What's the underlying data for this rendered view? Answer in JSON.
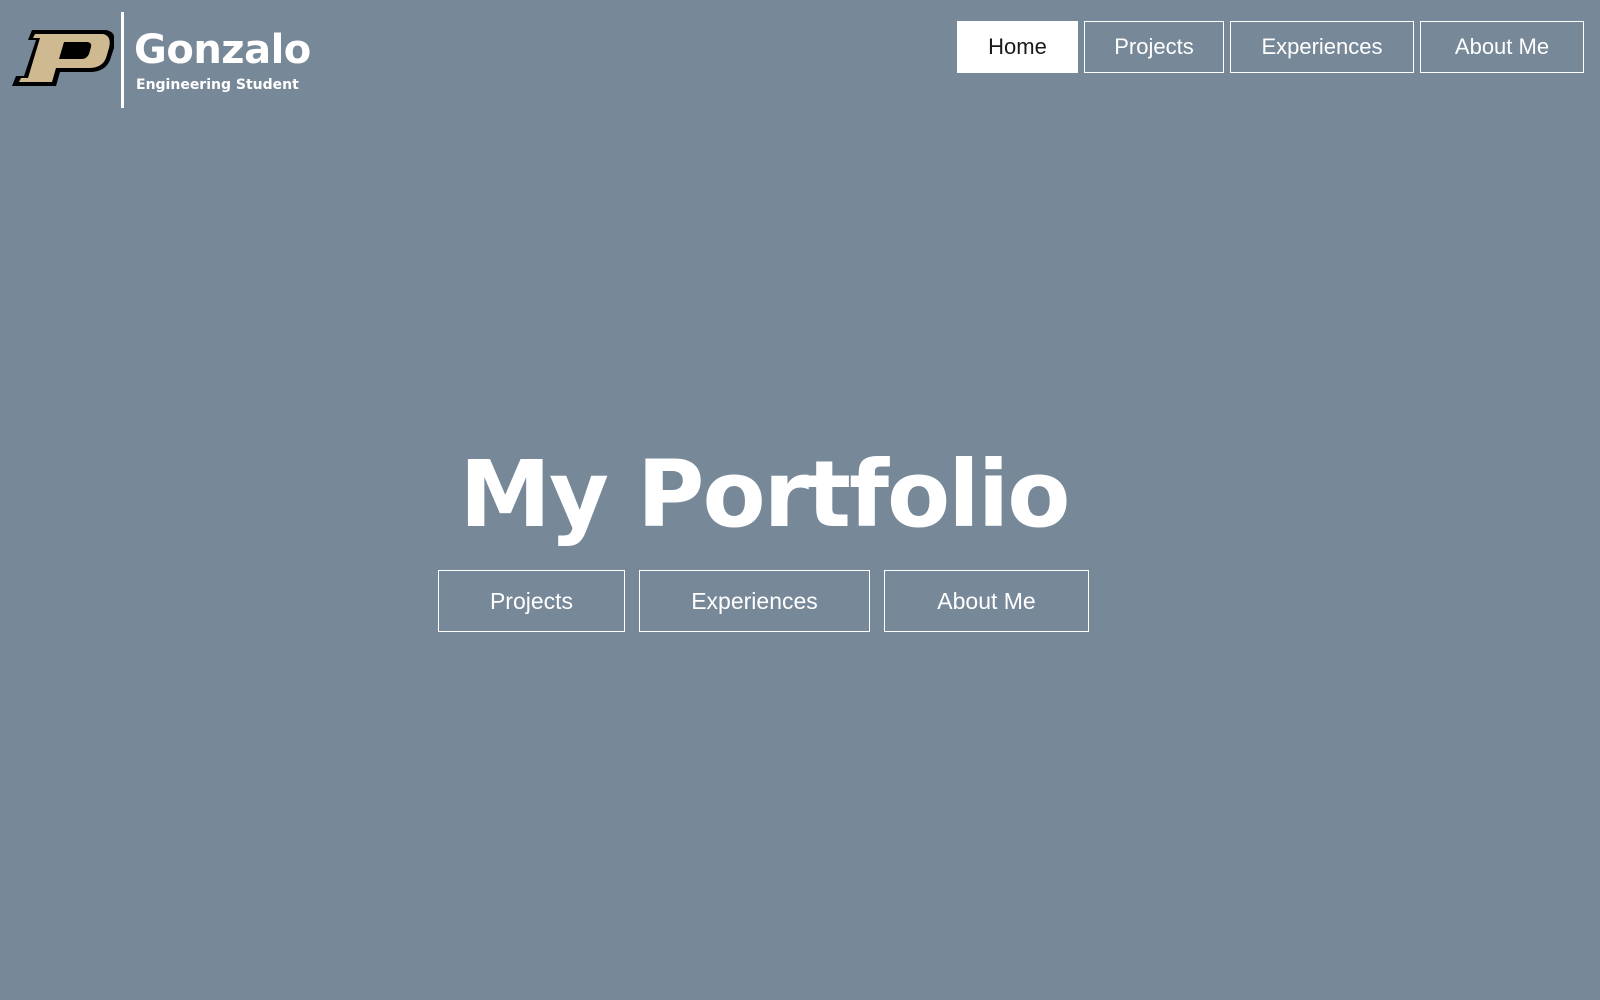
{
  "brand": {
    "logo_icon": "purdue-p-logo-icon",
    "name": "Gonzalo",
    "subtitle": "Engineering Student"
  },
  "nav": {
    "items": [
      {
        "label": "Home",
        "active": true
      },
      {
        "label": "Projects",
        "active": false
      },
      {
        "label": "Experiences",
        "active": false
      },
      {
        "label": "About Me",
        "active": false
      }
    ]
  },
  "hero": {
    "title": "My Portfolio",
    "buttons": [
      {
        "label": "Projects"
      },
      {
        "label": "Experiences"
      },
      {
        "label": "About Me"
      }
    ]
  },
  "colors": {
    "background": "#778899",
    "foreground": "#ffffff",
    "active_nav_text": "#1a1a1a",
    "logo_gold": "#CFB991",
    "logo_black": "#000000"
  }
}
